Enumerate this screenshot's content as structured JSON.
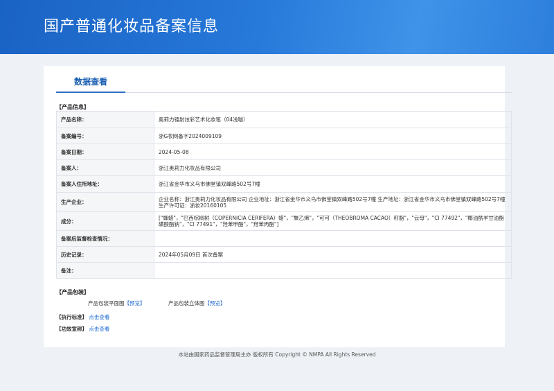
{
  "header": {
    "title": "国产普通化妆品备案信息"
  },
  "tab": {
    "label": "数据查看"
  },
  "product_info": {
    "section_label": "【产品信息】",
    "rows": [
      {
        "label": "产品名称：",
        "value": "奥莉力镭射炫彩艺术化妆笔（04浅咖）"
      },
      {
        "label": "备案编号：",
        "value": "浙G妆网备字2024009109"
      },
      {
        "label": "备案日期：",
        "value": "2024-05-08"
      },
      {
        "label": "备案人：",
        "value": "浙江奥莉力化妆品有限公司"
      },
      {
        "label": "备案人住所地址：",
        "value": "浙江省金华市义乌市佛堂镇双峰路502号7幢"
      },
      {
        "label": "生产企业：",
        "value": "企业名称：浙江奥莉力化妆品有限公司 企业地址：浙江省金华市义乌市佛堂镇双峰路502号7幢 生产地址：浙江省金华市义乌市佛堂镇双峰路502号7幢 生产许可证：浙妆20160105"
      },
      {
        "label": "成分：",
        "value": "[\"蜂蜡\"，\"巴西棕榈树（COPERNICIA CERIFERA）蜡\"，\"聚乙烯\"，\"可可（THEOBROMA CACAO）籽脂\"，\"云母\"，\"CI 77492\"，\"椰油酰羊甘油酯磺酸酯钠\"，\"CI 77491\"，\"羟苯甲酯\"，\"羟苯丙酯\"]"
      },
      {
        "label": "备案后监督检查情况：",
        "value": ""
      },
      {
        "label": "历史记录：",
        "value": "2024年05月09日 首次备案"
      },
      {
        "label": "备注：",
        "value": ""
      }
    ]
  },
  "packaging": {
    "section_label": "【产品包装】",
    "flat_label": "产品包装平面图",
    "flat_link": "【预览】",
    "3d_label": "产品包装立体图",
    "3d_link": "【预览】"
  },
  "standard": {
    "section_label": "【执行标准】",
    "link": "点击查看"
  },
  "efficacy": {
    "section_label": "【功效宣称】",
    "link": "点击查看"
  },
  "footer": {
    "text": "本站由国家药品监督管理局主办 版权所有 Copyright © NMPA All Rights Reserved"
  },
  "colors": {
    "header_blue": "#2678d9",
    "link_blue": "#1d6bd1",
    "tab_blue": "#1b5fb4"
  }
}
